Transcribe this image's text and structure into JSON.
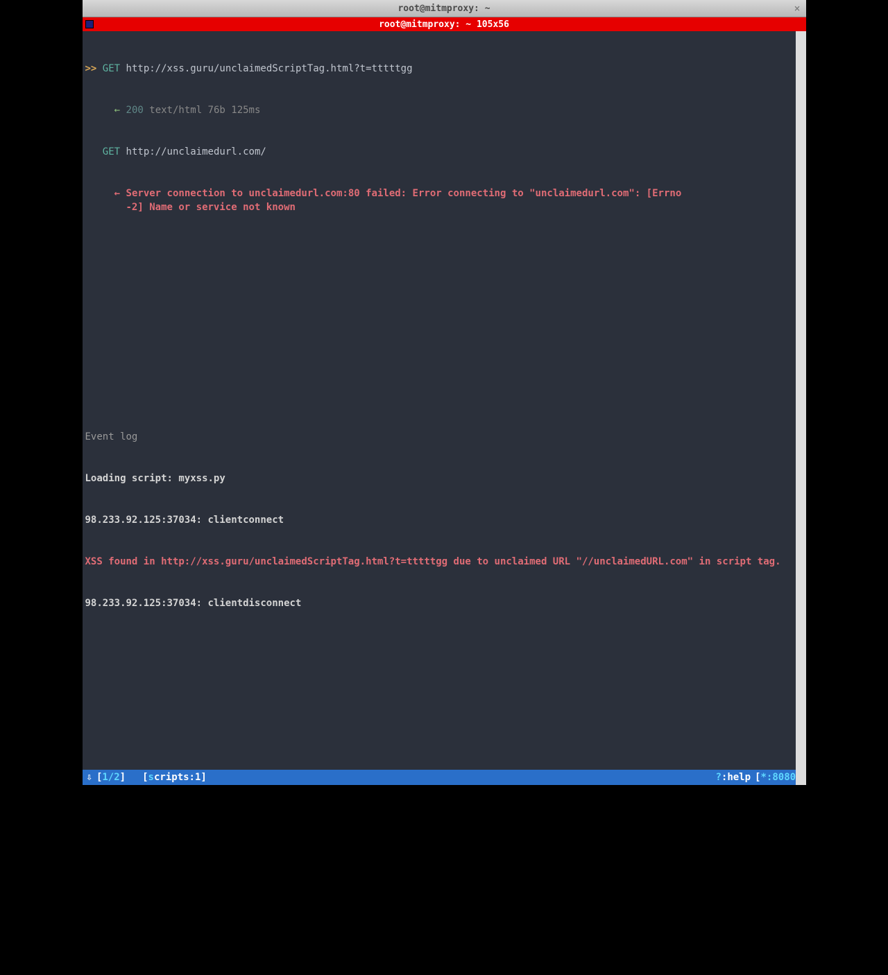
{
  "window": {
    "outer_title": "root@mitmproxy: ~",
    "inner_title": "root@mitmproxy: ~ 105x56",
    "close_glyph": "×"
  },
  "flows": [
    {
      "selected": true,
      "marker": ">>",
      "method": "GET",
      "url": "http://xss.guru/unclaimedScriptTag.html?t=tttttgg",
      "response": {
        "arrow": "←",
        "status": "200",
        "info": "text/html 76b 125ms"
      }
    },
    {
      "selected": false,
      "marker": "  ",
      "method": "GET",
      "url": "http://unclaimedurl.com/",
      "error": {
        "arrow": "←",
        "text": "Server connection to unclaimedurl.com:80 failed: Error connecting to \"unclaimedurl.com\": [Errno -2] Name or service not known"
      }
    }
  ],
  "eventlog": {
    "header": "Event log",
    "lines": [
      {
        "type": "info",
        "text": "Loading script: myxss.py"
      },
      {
        "type": "info",
        "text": "98.233.92.125:37034: clientconnect"
      },
      {
        "type": "alert",
        "text": "XSS found in http://xss.guru/unclaimedScriptTag.html?t=tttttgg due to unclaimed URL \"//unclaimedURL.com\" in script tag."
      },
      {
        "type": "info",
        "text": "98.233.92.125:37034: clientdisconnect"
      }
    ]
  },
  "statusbar": {
    "arrow": "⇩",
    "flow_pos": "1/2",
    "scripts_label": "s",
    "scripts_rest": "cripts:1",
    "help_q": "?",
    "help_text": ":help",
    "bind": "*:8080"
  }
}
